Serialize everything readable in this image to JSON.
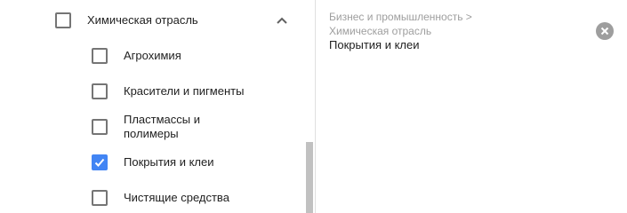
{
  "tree": {
    "parent": {
      "label": "Химическая отрасль",
      "checked": false,
      "expanded": true
    },
    "children": [
      {
        "label": "Агрохимия",
        "checked": false
      },
      {
        "label": "Красители и пигменты",
        "checked": false
      },
      {
        "label": "Пластмассы и полимеры",
        "checked": false
      },
      {
        "label": "Покрытия и клеи",
        "checked": true
      },
      {
        "label": "Чистящие средства",
        "checked": false
      }
    ]
  },
  "selection": {
    "breadcrumb": "Бизнес и промышленность > Химическая отрасль",
    "item": "Покрытия и клеи"
  },
  "icons": {
    "expand": "chevron-up-icon",
    "remove": "close-circle-icon",
    "check": "check-icon"
  },
  "colors": {
    "checked": "#4285f4",
    "checkbox_border": "#757575",
    "text": "#212121",
    "muted": "#9e9e9e"
  }
}
